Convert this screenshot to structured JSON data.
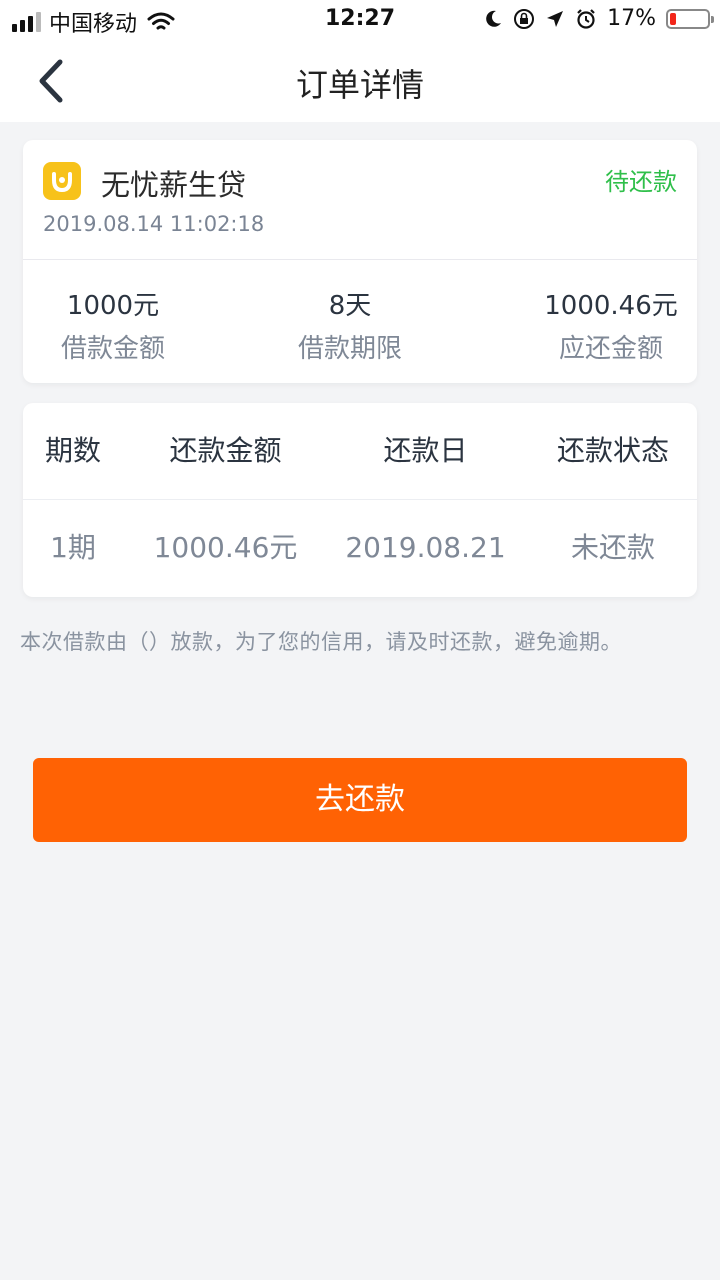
{
  "statusbar": {
    "carrier": "中国移动",
    "time": "12:27",
    "battery_text": "17%",
    "battery_level": 0.17
  },
  "navbar": {
    "title": "订单详情"
  },
  "order": {
    "product_name": "无忧薪生贷",
    "status": "待还款",
    "time": "2019.08.14 11:02:18",
    "stats": [
      {
        "value": "1000元",
        "label": "借款金额"
      },
      {
        "value": "8天",
        "label": "借款期限"
      },
      {
        "value": "1000.46元",
        "label": "应还金额"
      }
    ]
  },
  "schedule": {
    "headers": [
      "期数",
      "还款金额",
      "还款日",
      "还款状态"
    ],
    "rows": [
      [
        "1期",
        "1000.46元",
        "2019.08.21",
        "未还款"
      ]
    ]
  },
  "notice": "本次借款由（）放款，为了您的信用，请及时还款，避免逾期。",
  "pay_button": "去还款",
  "colors": {
    "accent": "#ff6204",
    "status_green": "#2fbf4a",
    "logo_yellow": "#f7c21a"
  },
  "icons": [
    "wifi-icon",
    "moon-icon",
    "rotation-lock-icon",
    "location-arrow-icon",
    "alarm-icon",
    "battery-icon",
    "back-chevron-icon",
    "product-logo-icon"
  ]
}
